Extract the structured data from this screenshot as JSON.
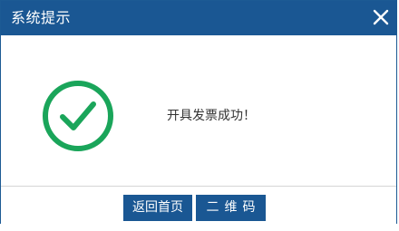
{
  "dialog": {
    "title": "系统提示",
    "close_icon": "close-icon",
    "status_icon": "check-circle-icon",
    "message": "开具发票成功！",
    "buttons": {
      "home_label": "返回首页",
      "qr_label": "二维码"
    }
  },
  "colors": {
    "titlebar": "#1a5793",
    "button": "#1a5793",
    "success": "#1aa55a",
    "message_text": "#333333"
  }
}
